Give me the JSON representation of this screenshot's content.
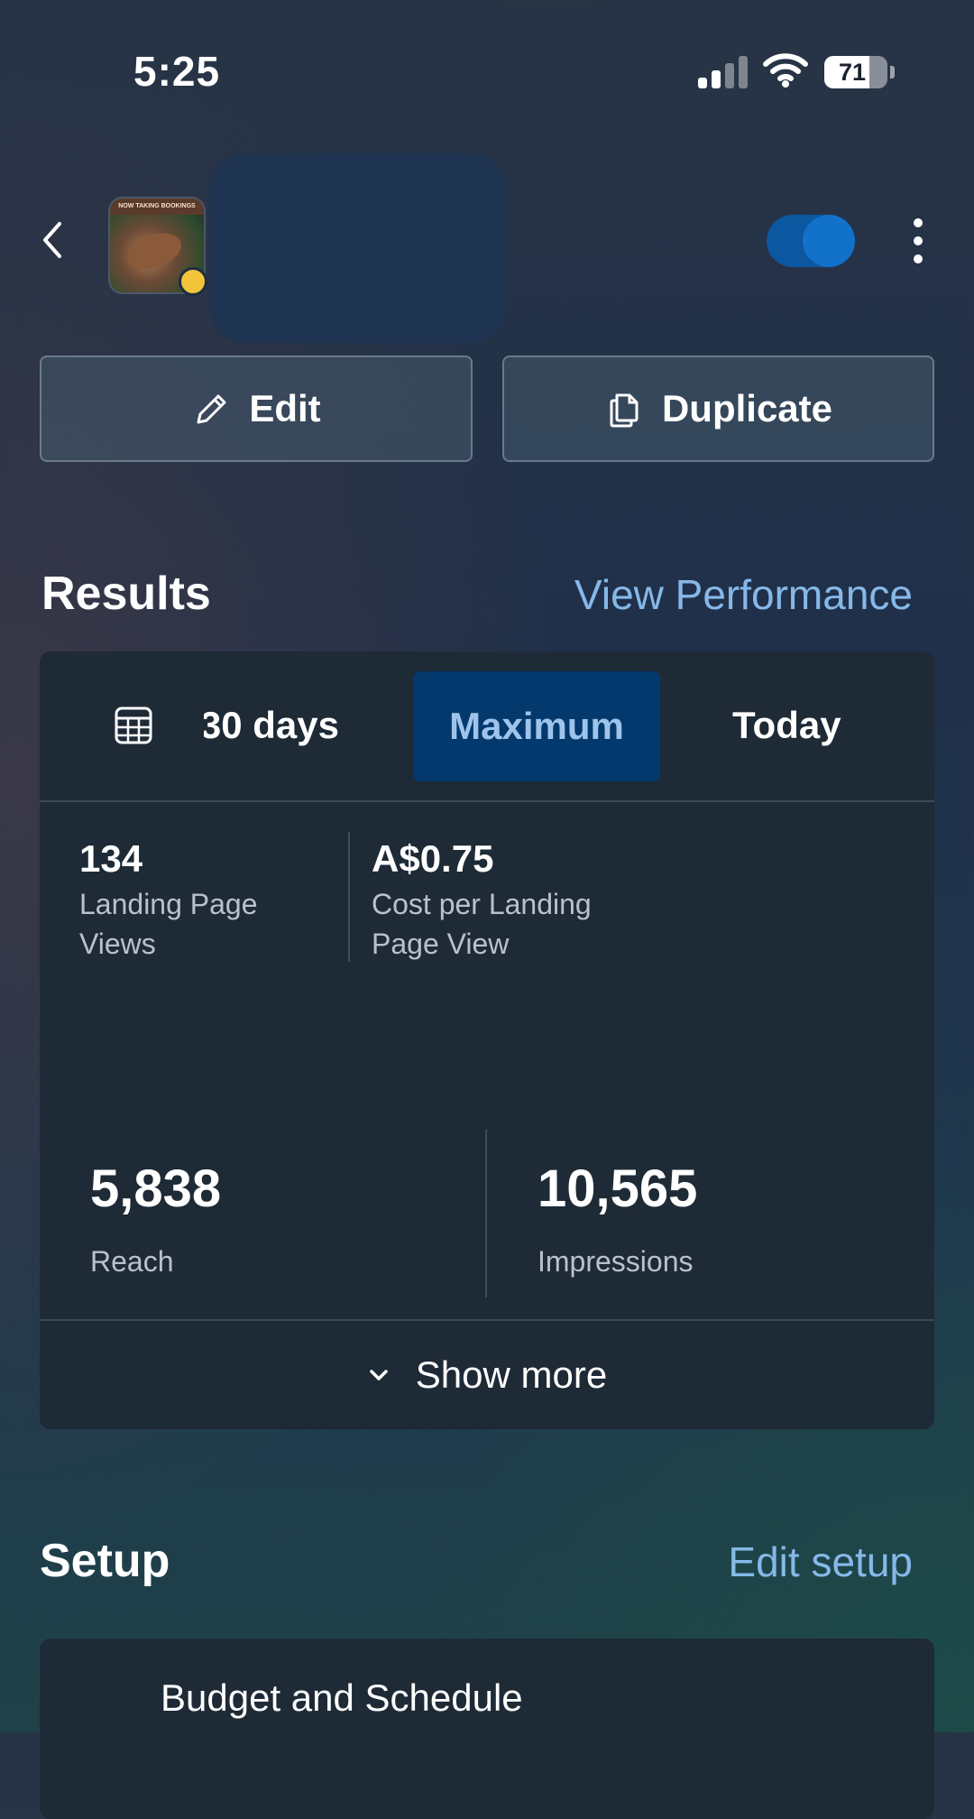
{
  "status_bar": {
    "time": "5:25",
    "battery_level": "71",
    "battery_fraction": 0.71,
    "signal_bars_active": 2,
    "signal_bars_total": 4
  },
  "header": {
    "toggle_state": "on",
    "status_dot_color": "#f3c33a",
    "thumbnail_banner": "NOW TAKING BOOKINGS"
  },
  "actions": {
    "edit_label": "Edit",
    "duplicate_label": "Duplicate"
  },
  "results": {
    "title": "Results",
    "link": "View Performance",
    "tabs": [
      {
        "label": "30 days",
        "active": false
      },
      {
        "label": "Maximum",
        "active": true
      },
      {
        "label": "Today",
        "active": false
      }
    ],
    "metrics": [
      {
        "value": "134",
        "label": "Landing Page Views"
      },
      {
        "value": "A$0.75",
        "label": "Cost per Landing Page View"
      },
      {
        "value": "5,838",
        "label": "Reach"
      },
      {
        "value": "10,565",
        "label": "Impressions"
      }
    ],
    "show_more": "Show more"
  },
  "setup": {
    "title": "Setup",
    "link": "Edit setup",
    "items": [
      {
        "label": "Budget and Schedule"
      }
    ]
  },
  "colors": {
    "accent_link": "#86b8e8",
    "active_tab_bg": "#03396c",
    "card_bg": "#1e2a36",
    "toggle": "#1271c8"
  }
}
